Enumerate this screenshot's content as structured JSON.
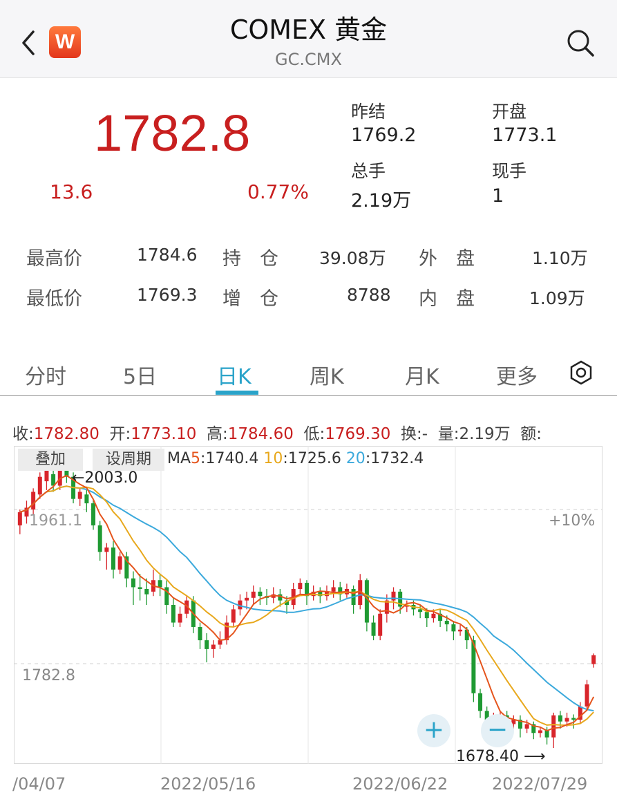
{
  "header": {
    "title": "COMEX 黄金",
    "subtitle": "GC.CMX",
    "logo_text": "W"
  },
  "quote": {
    "price": "1782.8",
    "change": "13.6",
    "change_pct": "0.77%",
    "stats": [
      {
        "label": "昨结",
        "value": "1769.2"
      },
      {
        "label": "开盘",
        "value": "1773.1"
      },
      {
        "label": "总手",
        "value": "2.19万"
      },
      {
        "label": "现手",
        "value": "1"
      }
    ],
    "rows": [
      [
        "最高价",
        "1784.6",
        "持　仓",
        "39.08万",
        "外　盘",
        "1.10万"
      ],
      [
        "最低价",
        "1769.3",
        "增　仓",
        "8788",
        "内　盘",
        "1.09万"
      ]
    ]
  },
  "tabs": [
    {
      "label": "分时",
      "active": false
    },
    {
      "label": "5日",
      "active": false
    },
    {
      "label": "日K",
      "active": true
    },
    {
      "label": "周K",
      "active": false
    },
    {
      "label": "月K",
      "active": false
    },
    {
      "label": "更多",
      "active": false
    }
  ],
  "ohlc": {
    "close_label": "收:",
    "close": "1782.80",
    "open_label": "开:",
    "open": "1773.10",
    "high_label": "高:",
    "high": "1784.60",
    "low_label": "低:",
    "low": "1769.30",
    "turnover_label": "换:-",
    "volume_label": "量:",
    "volume": "2.19万",
    "amount_label": "额:"
  },
  "chart_controls": {
    "overlay_label": "叠加",
    "period_label": "设周期",
    "ma_prefix": "MA",
    "ma5_key": "5",
    "ma5_val": ":1740.4",
    "ma10_key": "10",
    "ma10_val": ":1725.6",
    "ma20_key": "20",
    "ma20_val": ":1732.4"
  },
  "chart_labels": {
    "max_marker": "←2003.0",
    "level_label": "1961.1",
    "pct_label": "+10%",
    "current_label": "1782.8",
    "min_marker": "1678.40 ⟶",
    "zoom_in": "+",
    "zoom_out": "−"
  },
  "dates": [
    "/04/07",
    "2022/05/16",
    "2022/06/22",
    "2022/07/29"
  ],
  "colors": {
    "up": "#d8252b",
    "down": "#1f9a33",
    "ma5": "#e5541c",
    "ma10": "#e8a81c",
    "ma20": "#3ba9dc",
    "accent": "#2aa3c9"
  },
  "chart_data": {
    "type": "candlestick",
    "ylim": [
      1660,
      2020
    ],
    "candles": [
      [
        1930,
        1945,
        1920,
        1948
      ],
      [
        1940,
        1950,
        1932,
        1958
      ],
      [
        1948,
        1968,
        1942,
        1972
      ],
      [
        1965,
        1985,
        1960,
        1990
      ],
      [
        1980,
        1992,
        1970,
        1998
      ],
      [
        1988,
        1975,
        1968,
        1995
      ],
      [
        1975,
        1995,
        1970,
        2000
      ],
      [
        1993,
        1985,
        1978,
        2003
      ],
      [
        1985,
        1960,
        1955,
        1990
      ],
      [
        1960,
        1968,
        1952,
        1972
      ],
      [
        1965,
        1955,
        1945,
        1970
      ],
      [
        1955,
        1930,
        1925,
        1960
      ],
      [
        1930,
        1900,
        1890,
        1935
      ],
      [
        1900,
        1905,
        1880,
        1910
      ],
      [
        1905,
        1880,
        1870,
        1912
      ],
      [
        1880,
        1895,
        1875,
        1900
      ],
      [
        1895,
        1870,
        1860,
        1900
      ],
      [
        1870,
        1860,
        1840,
        1878
      ],
      [
        1860,
        1858,
        1845,
        1875
      ],
      [
        1858,
        1852,
        1840,
        1870
      ],
      [
        1855,
        1868,
        1850,
        1880
      ],
      [
        1868,
        1860,
        1850,
        1875
      ],
      [
        1860,
        1840,
        1830,
        1868
      ],
      [
        1840,
        1820,
        1815,
        1848
      ],
      [
        1820,
        1830,
        1815,
        1838
      ],
      [
        1830,
        1845,
        1825,
        1850
      ],
      [
        1845,
        1815,
        1808,
        1850
      ],
      [
        1815,
        1800,
        1790,
        1820
      ],
      [
        1800,
        1790,
        1775,
        1808
      ],
      [
        1790,
        1795,
        1780,
        1800
      ],
      [
        1795,
        1800,
        1790,
        1810
      ],
      [
        1800,
        1820,
        1795,
        1828
      ],
      [
        1820,
        1835,
        1815,
        1840
      ],
      [
        1835,
        1845,
        1828,
        1852
      ],
      [
        1845,
        1848,
        1835,
        1855
      ],
      [
        1848,
        1855,
        1840,
        1862
      ],
      [
        1855,
        1850,
        1840,
        1860
      ],
      [
        1850,
        1848,
        1840,
        1858
      ],
      [
        1848,
        1852,
        1842,
        1860
      ],
      [
        1852,
        1845,
        1838,
        1858
      ],
      [
        1845,
        1840,
        1830,
        1850
      ],
      [
        1840,
        1858,
        1835,
        1865
      ],
      [
        1858,
        1865,
        1850,
        1870
      ],
      [
        1865,
        1850,
        1840,
        1868
      ],
      [
        1850,
        1855,
        1845,
        1862
      ],
      [
        1855,
        1850,
        1842,
        1860
      ],
      [
        1850,
        1855,
        1845,
        1862
      ],
      [
        1855,
        1860,
        1848,
        1868
      ],
      [
        1860,
        1852,
        1845,
        1866
      ],
      [
        1852,
        1858,
        1848,
        1864
      ],
      [
        1858,
        1840,
        1830,
        1862
      ],
      [
        1840,
        1868,
        1835,
        1875
      ],
      [
        1868,
        1820,
        1810,
        1870
      ],
      [
        1820,
        1805,
        1800,
        1828
      ],
      [
        1805,
        1830,
        1800,
        1835
      ],
      [
        1830,
        1845,
        1820,
        1852
      ],
      [
        1845,
        1855,
        1835,
        1860
      ],
      [
        1855,
        1838,
        1830,
        1858
      ],
      [
        1838,
        1840,
        1832,
        1845
      ],
      [
        1840,
        1835,
        1828,
        1845
      ],
      [
        1835,
        1832,
        1825,
        1840
      ],
      [
        1832,
        1825,
        1815,
        1836
      ],
      [
        1825,
        1830,
        1820,
        1835
      ],
      [
        1830,
        1822,
        1815,
        1835
      ],
      [
        1822,
        1818,
        1810,
        1828
      ],
      [
        1818,
        1810,
        1800,
        1822
      ],
      [
        1810,
        1812,
        1805,
        1818
      ],
      [
        1812,
        1800,
        1790,
        1815
      ],
      [
        1800,
        1740,
        1730,
        1805
      ],
      [
        1740,
        1720,
        1712,
        1745
      ],
      [
        1720,
        1710,
        1700,
        1725
      ],
      [
        1710,
        1712,
        1705,
        1718
      ],
      [
        1712,
        1715,
        1705,
        1720
      ],
      [
        1715,
        1705,
        1695,
        1720
      ],
      [
        1705,
        1710,
        1700,
        1715
      ],
      [
        1710,
        1700,
        1690,
        1715
      ],
      [
        1700,
        1705,
        1695,
        1710
      ],
      [
        1705,
        1695,
        1688,
        1708
      ],
      [
        1695,
        1698,
        1690,
        1702
      ],
      [
        1698,
        1690,
        1682,
        1702
      ],
      [
        1690,
        1715,
        1678,
        1718
      ],
      [
        1715,
        1708,
        1700,
        1720
      ],
      [
        1708,
        1712,
        1702,
        1718
      ],
      [
        1712,
        1710,
        1700,
        1716
      ],
      [
        1710,
        1725,
        1705,
        1730
      ],
      [
        1725,
        1750,
        1720,
        1755
      ],
      [
        1773,
        1783,
        1769,
        1785
      ]
    ]
  }
}
